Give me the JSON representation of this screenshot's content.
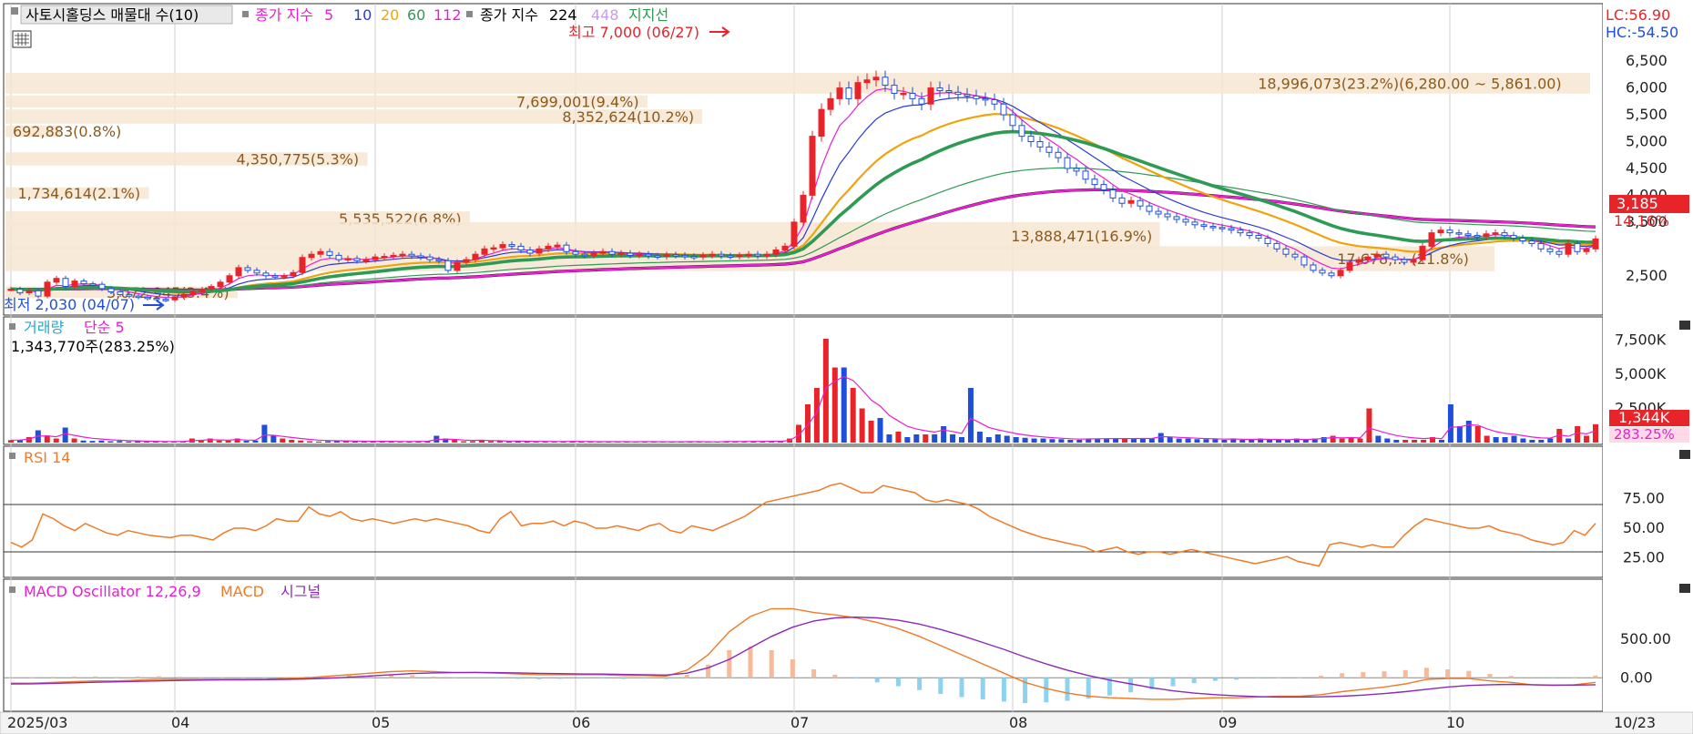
{
  "price_panel": {
    "legend": {
      "title": "사토시홀딩스 매물대 수(10)",
      "ma_prefix": "종가 지수",
      "ma_periods": [
        "5",
        "10",
        "20",
        "60",
        "112"
      ],
      "ma2_prefix": "종가 지수",
      "ma2_periods": [
        "224",
        "448"
      ],
      "support": "지지선"
    },
    "lc": "LC:56.90",
    "hc": "HC:-54.50",
    "high_marker": "최고 7,000 (06/27)",
    "low_marker": "최저 2,030 (04/07)",
    "current_price": "3,185",
    "current_change": "14.16%",
    "y_ticks": [
      "6,500",
      "6,000",
      "5,500",
      "5,000",
      "4,500",
      "4,000",
      "3,500",
      "2,500"
    ]
  },
  "volume_profile": [
    {
      "label": "18,996,073(23.2%)(6,280.00 ~ 5,861.00)",
      "pct": 23.2
    },
    {
      "label": "7,699,001(9.4%)",
      "pct": 9.4
    },
    {
      "label": "8,352,624(10.2%)",
      "pct": 10.2
    },
    {
      "label": "692,883(0.8%)",
      "pct": 0.8
    },
    {
      "label": "4,350,775(5.3%)",
      "pct": 5.3
    },
    {
      "label": "1,734,614(2.1%)",
      "pct": 2.1
    },
    {
      "label": "5,535,522(6.8%)",
      "pct": 6.8
    },
    {
      "label": "13,888,471(16.9%)",
      "pct": 16.9
    },
    {
      "label": "17,678,... (21.8%)",
      "pct": 21.8
    },
    {
      "label": "3,072,945(3.4%)",
      "pct": 3.4
    }
  ],
  "volume_panel": {
    "legend_a": "거래량",
    "legend_b": "단순 5",
    "sub": "1,343,770주(283.25%)",
    "current": "1,344K",
    "current_pct": "283.25%",
    "y_ticks": [
      "7,500K",
      "5,000K",
      "2,500K"
    ]
  },
  "rsi_panel": {
    "legend": "RSI 14",
    "y_ticks": [
      "75.00",
      "50.00",
      "25.00"
    ]
  },
  "macd_panel": {
    "legend_a": "MACD Oscillator 12,26,9",
    "legend_b": "MACD",
    "legend_c": "시그널",
    "y_ticks": [
      "500.00",
      "0.00"
    ]
  },
  "x_axis": {
    "labels": [
      "2025/03",
      "04",
      "05",
      "06",
      "07",
      "08",
      "09",
      "10"
    ],
    "right_label": "10/23"
  },
  "colors": {
    "up": "#e8242b",
    "down": "#1f4fd8",
    "ma5": "#e91fd0",
    "ma10": "#2d3bd3",
    "ma20": "#f0a30a",
    "ma60": "#2e9a54",
    "ma112": "#e91fd0",
    "ma224": "#000000",
    "ma448": "#c69cf0",
    "rsi": "#f07a28",
    "macd": "#f07a28",
    "signal": "#8a2bb8",
    "profile": "#f7e6d2"
  },
  "chart_data": {
    "type": "line",
    "title": "사토시홀딩스",
    "months": [
      "2025/03",
      "04",
      "05",
      "06",
      "07",
      "08",
      "09",
      "10"
    ],
    "close": [
      2250,
      2180,
      2220,
      2120,
      2380,
      2450,
      2300,
      2400,
      2350,
      2340,
      2260,
      2200,
      2150,
      2120,
      2100,
      2080,
      2060,
      2050,
      2100,
      2150,
      2200,
      2250,
      2300,
      2380,
      2500,
      2650,
      2600,
      2550,
      2500,
      2480,
      2500,
      2560,
      2840,
      2900,
      2950,
      2880,
      2800,
      2820,
      2780,
      2800,
      2850,
      2860,
      2880,
      2900,
      2870,
      2850,
      2800,
      2780,
      2600,
      2750,
      2800,
      2900,
      3000,
      3020,
      3080,
      3050,
      2980,
      2920,
      3000,
      3050,
      3070,
      2950,
      2900,
      2880,
      2920,
      2950,
      2900,
      2920,
      2880,
      2900,
      2870,
      2860,
      2890,
      2880,
      2860,
      2850,
      2880,
      2900,
      2870,
      2860,
      2880,
      2900,
      2870,
      2900,
      2980,
      3050,
      3500,
      4000,
      5100,
      5600,
      5800,
      6000,
      5800,
      6100,
      6150,
      6200,
      6050,
      5900,
      5900,
      5800,
      5700,
      6000,
      5950,
      5920,
      5880,
      5850,
      5800,
      5780,
      5700,
      5500,
      5300,
      5100,
      5000,
      4900,
      4800,
      4700,
      4500,
      4450,
      4300,
      4200,
      4100,
      3950,
      3850,
      3900,
      3800,
      3700,
      3650,
      3600,
      3550,
      3500,
      3450,
      3420,
      3400,
      3380,
      3350,
      3300,
      3250,
      3200,
      3100,
      3000,
      2900,
      2850,
      2700,
      2600,
      2550,
      2500,
      2600,
      2750,
      2800,
      2850,
      2900,
      2850,
      2800,
      2750,
      2800,
      3050,
      3300,
      3350,
      3300,
      3280,
      3250,
      3230,
      3280,
      3300,
      3250,
      3200,
      3150,
      3100,
      3000,
      2950,
      2900,
      3100,
      2950,
      3000,
      3185
    ],
    "volume_k": [
      180,
      200,
      400,
      900,
      520,
      300,
      1100,
      300,
      150,
      120,
      150,
      100,
      120,
      80,
      100,
      60,
      60,
      60,
      60,
      70,
      300,
      200,
      300,
      150,
      150,
      300,
      130,
      150,
      1300,
      500,
      300,
      200,
      150,
      100,
      80,
      100,
      100,
      100,
      70,
      90,
      80,
      100,
      80,
      60,
      80,
      100,
      100,
      500,
      300,
      200,
      100,
      100,
      200,
      100,
      100,
      80,
      100,
      80,
      60,
      80,
      80,
      60,
      100,
      80,
      60,
      50,
      60,
      80,
      60,
      50,
      80,
      60,
      60,
      50,
      60,
      80,
      60,
      50,
      50,
      100,
      80,
      100,
      100,
      80,
      100,
      100,
      300,
      1300,
      2800,
      4000,
      7600,
      5500,
      5500,
      4000,
      2500,
      1600,
      1800,
      600,
      800,
      400,
      600,
      600,
      600,
      1200,
      600,
      400,
      4000,
      800,
      400,
      600,
      500,
      400,
      350,
      300,
      300,
      250,
      250,
      200,
      200,
      300,
      300,
      300,
      300,
      300,
      300,
      300,
      300,
      700,
      400,
      300,
      300,
      250,
      250,
      250,
      200,
      300,
      200,
      200,
      300,
      200,
      200,
      200,
      300,
      200,
      300,
      400,
      500,
      300,
      400,
      300,
      2500,
      500,
      300,
      200,
      200,
      200,
      200,
      400,
      200,
      2800,
      1200,
      1600,
      1200,
      500,
      400,
      400,
      500,
      300,
      200,
      200,
      300,
      1000,
      300,
      1200,
      500,
      1344
    ],
    "rsi": [
      38,
      34,
      40,
      62,
      58,
      52,
      48,
      54,
      50,
      46,
      44,
      48,
      46,
      44,
      43,
      42,
      44,
      44,
      42,
      40,
      46,
      50,
      50,
      48,
      52,
      58,
      56,
      56,
      68,
      62,
      60,
      64,
      58,
      56,
      58,
      56,
      54,
      56,
      58,
      56,
      58,
      56,
      54,
      52,
      48,
      46,
      58,
      64,
      52,
      54,
      54,
      56,
      52,
      56,
      54,
      50,
      50,
      52,
      50,
      48,
      52,
      54,
      48,
      46,
      52,
      50,
      48,
      52,
      56,
      60,
      66,
      72,
      74,
      76,
      78,
      80,
      82,
      86,
      88,
      84,
      80,
      80,
      86,
      84,
      82,
      80,
      74,
      72,
      74,
      72,
      70,
      66,
      60,
      56,
      52,
      48,
      45,
      42,
      40,
      38,
      36,
      34,
      30,
      32,
      34,
      30,
      28,
      30,
      30,
      28,
      30,
      32,
      30,
      28,
      26,
      24,
      22,
      20,
      22,
      24,
      26,
      22,
      20,
      18,
      36,
      38,
      36,
      34,
      36,
      34,
      34,
      44,
      52,
      58,
      56,
      54,
      52,
      50,
      50,
      52,
      48,
      46,
      44,
      40,
      38,
      36,
      38,
      48,
      44,
      54
    ],
    "macd": [
      -70,
      -70,
      -60,
      -50,
      -40,
      -40,
      -30,
      -20,
      -20,
      -20,
      -20,
      -20,
      -20,
      -10,
      0,
      20,
      40,
      60,
      80,
      90,
      80,
      70,
      70,
      60,
      50,
      40,
      40,
      40,
      40,
      30,
      30,
      20,
      100,
      300,
      600,
      800,
      900,
      900,
      850,
      820,
      780,
      720,
      640,
      540,
      420,
      300,
      180,
      60,
      -60,
      -140,
      -200,
      -240,
      -260,
      -270,
      -280,
      -280,
      -270,
      -260,
      -260,
      -250,
      -240,
      -240,
      -220,
      -180,
      -150,
      -120,
      -80,
      -20,
      -10,
      -10,
      -40,
      -60,
      -90,
      -100,
      -90,
      -60
    ],
    "signal": [
      -80,
      -78,
      -72,
      -66,
      -58,
      -52,
      -46,
      -40,
      -34,
      -30,
      -28,
      -26,
      -24,
      -20,
      -15,
      -6,
      8,
      24,
      40,
      56,
      64,
      68,
      70,
      68,
      64,
      58,
      54,
      50,
      48,
      44,
      40,
      36,
      60,
      130,
      240,
      390,
      540,
      660,
      740,
      780,
      790,
      780,
      750,
      700,
      630,
      550,
      460,
      370,
      270,
      180,
      100,
      30,
      -30,
      -80,
      -130,
      -170,
      -200,
      -220,
      -235,
      -245,
      -250,
      -250,
      -248,
      -240,
      -225,
      -205,
      -180,
      -150,
      -120,
      -100,
      -90,
      -85,
      -90,
      -95,
      -95,
      -90
    ],
    "ylim": [
      1800,
      7300
    ]
  }
}
